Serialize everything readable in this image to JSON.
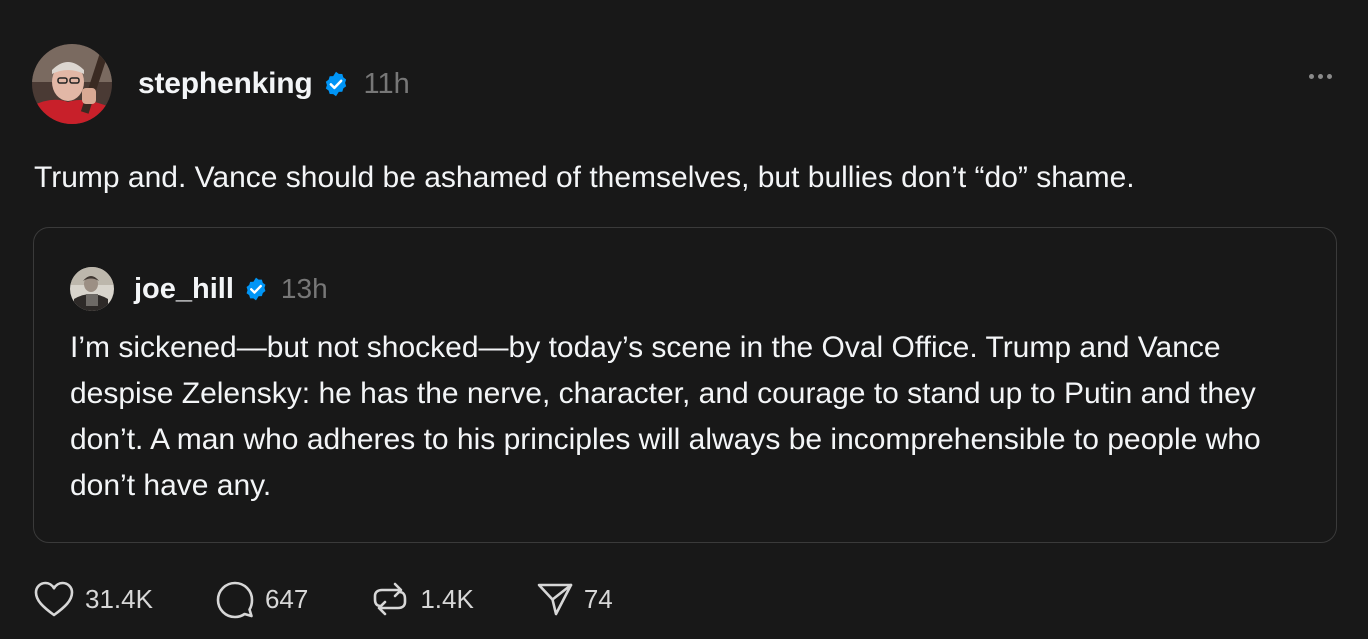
{
  "post": {
    "author": "stephenking",
    "time": "11h",
    "text": "Trump and. Vance should be ashamed of themselves, but bullies don’t “do” shame.",
    "more_icon": "more-horizontal-icon"
  },
  "quote": {
    "author": "joe_hill",
    "time": "13h",
    "text": "I’m sickened—but not shocked—by today’s scene in the Oval Office. Trump and Vance despise Zelensky: he has the nerve, character, and courage to stand up to Putin and they don’t. A man who adheres to his principles will always be incomprehensible to people who don’t have any."
  },
  "actions": {
    "likes": "31.4K",
    "replies": "647",
    "reposts": "1.4K",
    "shares": "74"
  },
  "colors": {
    "background": "#181818",
    "text": "#f3f5f7",
    "muted": "#777777",
    "verified": "#0095f6",
    "border": "#3a3a3a"
  }
}
